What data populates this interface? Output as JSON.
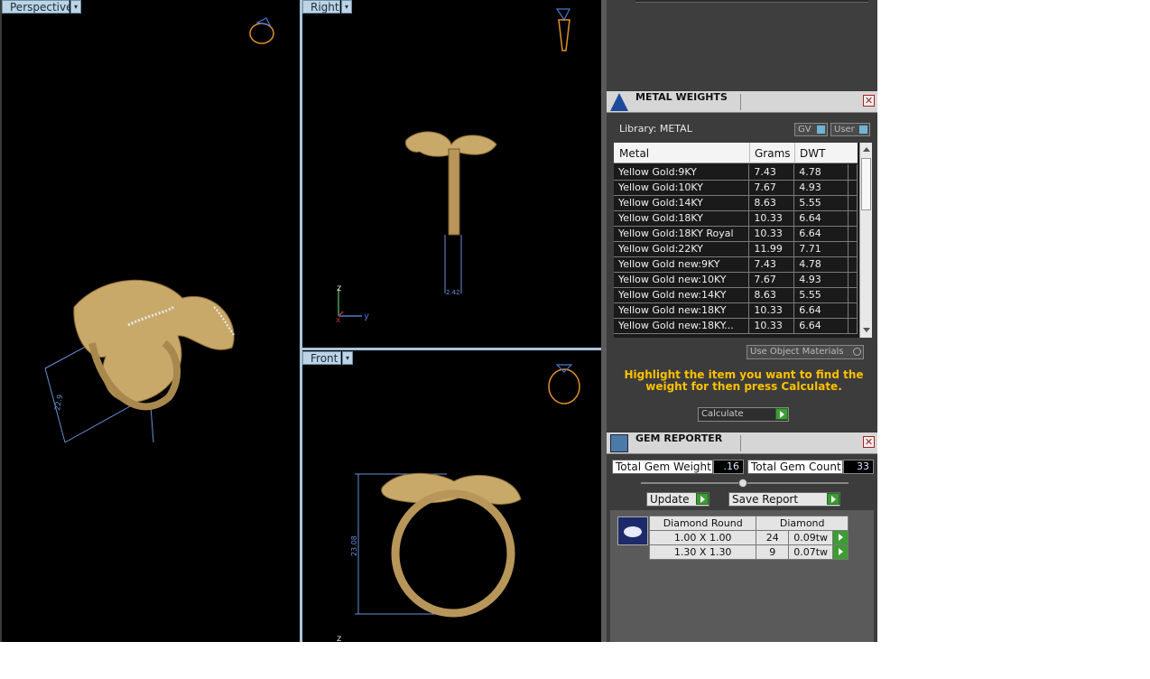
{
  "viewports": {
    "perspective": {
      "label": "Perspective",
      "dimension": "22.9"
    },
    "right": {
      "label": "Right",
      "dimension": "2.42",
      "axis_z": "z",
      "axis_y": "y",
      "axis_x": "x"
    },
    "front": {
      "label": "Front",
      "dimension": "23.08",
      "axis_z": "z"
    }
  },
  "metal_weights": {
    "title": "METAL WEIGHTS",
    "library_label": "Library: METAL",
    "gv_label": "GV",
    "user_label": "User",
    "columns": [
      "Metal",
      "Grams",
      "DWT"
    ],
    "rows": [
      {
        "metal": "Yellow Gold:9KY",
        "grams": "7.43",
        "dwt": "4.78"
      },
      {
        "metal": "Yellow Gold:10KY",
        "grams": "7.67",
        "dwt": "4.93"
      },
      {
        "metal": "Yellow Gold:14KY",
        "grams": "8.63",
        "dwt": "5.55"
      },
      {
        "metal": "Yellow Gold:18KY",
        "grams": "10.33",
        "dwt": "6.64"
      },
      {
        "metal": "Yellow Gold:18KY Royal",
        "grams": "10.33",
        "dwt": "6.64"
      },
      {
        "metal": "Yellow Gold:22KY",
        "grams": "11.99",
        "dwt": "7.71"
      },
      {
        "metal": "Yellow Gold new:9KY",
        "grams": "7.43",
        "dwt": "4.78"
      },
      {
        "metal": "Yellow Gold new:10KY",
        "grams": "7.67",
        "dwt": "4.93"
      },
      {
        "metal": "Yellow Gold new:14KY",
        "grams": "8.63",
        "dwt": "5.55"
      },
      {
        "metal": "Yellow Gold new:18KY",
        "grams": "10.33",
        "dwt": "6.64"
      },
      {
        "metal": "Yellow Gold new:18KY...",
        "grams": "10.33",
        "dwt": "6.64"
      }
    ],
    "use_object_materials": "Use Object Materials",
    "instruction": "Highlight the item you want to find the weight for then press Calculate.",
    "calculate_label": "Calculate"
  },
  "gem_reporter": {
    "title": "GEM REPORTER",
    "total_weight_label": "Total Gem Weight",
    "total_weight_value": ".16",
    "total_count_label": "Total Gem Count",
    "total_count_value": "33",
    "update_label": "Update",
    "save_report_label": "Save Report",
    "header_shape": "Diamond Round",
    "header_material": "Diamond",
    "rows": [
      {
        "size": "1.00 X 1.00",
        "count": "24",
        "tw": "0.09tw"
      },
      {
        "size": "1.30 X 1.30",
        "count": "9",
        "tw": "0.07tw"
      }
    ]
  },
  "colors": {
    "gold": "#c8a96a",
    "instruction": "#ffc000",
    "viewport_label": "#bcd4e4"
  }
}
